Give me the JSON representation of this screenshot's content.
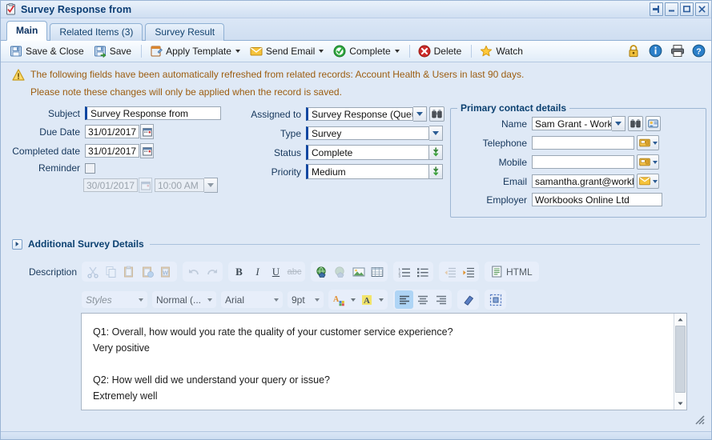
{
  "window": {
    "title": "Survey Response from",
    "icon": "clipboard-check-icon",
    "buttons": [
      {
        "name": "pin-window-button",
        "icon": "pin-icon"
      },
      {
        "name": "minimize-window-button",
        "icon": "minimize-icon"
      },
      {
        "name": "maximize-window-button",
        "icon": "maximize-icon"
      },
      {
        "name": "close-window-button",
        "icon": "close-icon"
      }
    ]
  },
  "tabs": [
    {
      "label": "Main",
      "active": true
    },
    {
      "label": "Related Items (3)",
      "active": false
    },
    {
      "label": "Survey Result",
      "active": false
    }
  ],
  "toolbar": {
    "save_close_label": "Save & Close",
    "save_label": "Save",
    "apply_template_label": "Apply Template",
    "send_email_label": "Send Email",
    "complete_label": "Complete",
    "delete_label": "Delete",
    "watch_label": "Watch",
    "right_icons": [
      {
        "name": "lock-icon"
      },
      {
        "name": "info-icon"
      },
      {
        "name": "print-icon"
      },
      {
        "name": "help-icon"
      }
    ]
  },
  "notice": {
    "line1": "The following fields have been automatically refreshed from related records: Account Health & Users in last 90 days.",
    "line2": "Please note these changes will only be applied when the record is saved.",
    "color": "#9c5d10"
  },
  "form": {
    "left": {
      "subject_label": "Subject",
      "subject_value": "Survey Response from",
      "due_date_label": "Due Date",
      "due_date_value": "31/01/2017",
      "completed_date_label": "Completed date",
      "completed_date_value": "31/01/2017",
      "reminder_label": "Reminder",
      "reminder_checked": false,
      "reminder_date_value": "30/01/2017",
      "reminder_time_value": "10:00 AM"
    },
    "middle": {
      "assigned_to_label": "Assigned to",
      "assigned_to_value": "Survey Response (Queue",
      "type_label": "Type",
      "type_value": "Survey",
      "status_label": "Status",
      "status_value": "Complete",
      "priority_label": "Priority",
      "priority_value": "Medium"
    },
    "contact_panel": {
      "legend": "Primary contact details",
      "name_label": "Name",
      "name_value": "Sam Grant - Workb",
      "telephone_label": "Telephone",
      "telephone_value": "",
      "mobile_label": "Mobile",
      "mobile_value": "",
      "email_label": "Email",
      "email_value": "samantha.grant@workbo",
      "employer_label": "Employer",
      "employer_value": "Workbooks Online Ltd"
    }
  },
  "section": {
    "title": "Additional Survey Details",
    "expanded": false
  },
  "editor": {
    "description_label": "Description",
    "row1": {
      "group1": [
        "cut-icon",
        "copy-icon",
        "paste-icon",
        "paste-text-icon",
        "paste-word-icon"
      ],
      "group2": [
        "undo-icon",
        "redo-icon"
      ],
      "group3": [
        "bold-icon",
        "italic-icon",
        "underline-icon",
        "strikethrough-icon"
      ],
      "group4": [
        "insert-link-icon",
        "unlink-icon",
        "insert-image-icon",
        "insert-table-icon"
      ],
      "group5": [
        "ordered-list-icon",
        "unordered-list-icon"
      ],
      "group6": [
        "outdent-icon",
        "indent-icon"
      ],
      "group7_label": "HTML",
      "group7_icon": "html-source-icon"
    },
    "row2": {
      "styles_value": "Styles",
      "format_value": "Normal (...",
      "font_value": "Arial",
      "size_value": "9pt",
      "text_color_icon": "text-color-icon",
      "bg_color_icon": "background-color-icon",
      "align_left_icon": "align-left-icon",
      "align_center_icon": "align-center-icon",
      "align_right_icon": "align-right-icon",
      "remove_format_icon": "remove-format-icon",
      "maximize_editor_icon": "maximize-editor-icon"
    },
    "content": [
      {
        "question": "Q1: Overall, how would you rate the quality of your customer service experience?",
        "answer": "Very positive"
      },
      {
        "question": "Q2: How well did we understand your query or issue?",
        "answer": "Extremely well"
      }
    ]
  },
  "colors": {
    "accent": "#0b4070",
    "window_bg": "#dfe9f6",
    "field_required": "#0d47a1",
    "notice": "#9c5d10"
  }
}
